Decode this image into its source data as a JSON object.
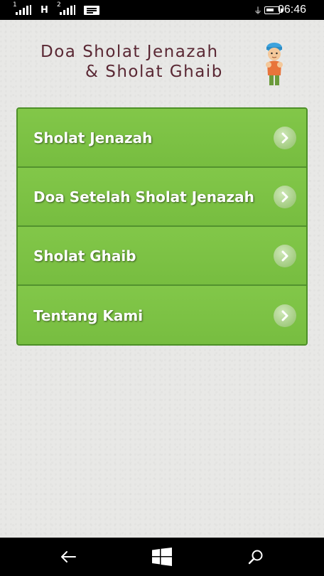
{
  "status_bar": {
    "sim1_label": "1",
    "network_type": "H",
    "sim2_label": "2",
    "time": "06:46",
    "icons": [
      "signal-icon",
      "signal-icon",
      "message-icon",
      "battery-charging-icon"
    ]
  },
  "header": {
    "title_line1": "Doa Sholat Jenazah",
    "title_line2": "& Sholat Ghaib",
    "mascot_icon": "mascot-praying-boy-icon"
  },
  "menu": {
    "items": [
      {
        "label": "Sholat Jenazah",
        "icon": "chevron-right-icon"
      },
      {
        "label": "Doa Setelah Sholat Jenazah",
        "icon": "chevron-right-icon"
      },
      {
        "label": "Sholat Ghaib",
        "icon": "chevron-right-icon"
      },
      {
        "label": "Tentang Kami",
        "icon": "chevron-right-icon"
      }
    ]
  },
  "nav_bar": {
    "buttons": [
      "back-icon",
      "windows-start-icon",
      "search-icon"
    ]
  },
  "colors": {
    "menu_green": "#7cc244",
    "menu_border": "#4d8f28",
    "title_maroon": "#5a2834",
    "background": "#e8e8e6"
  }
}
